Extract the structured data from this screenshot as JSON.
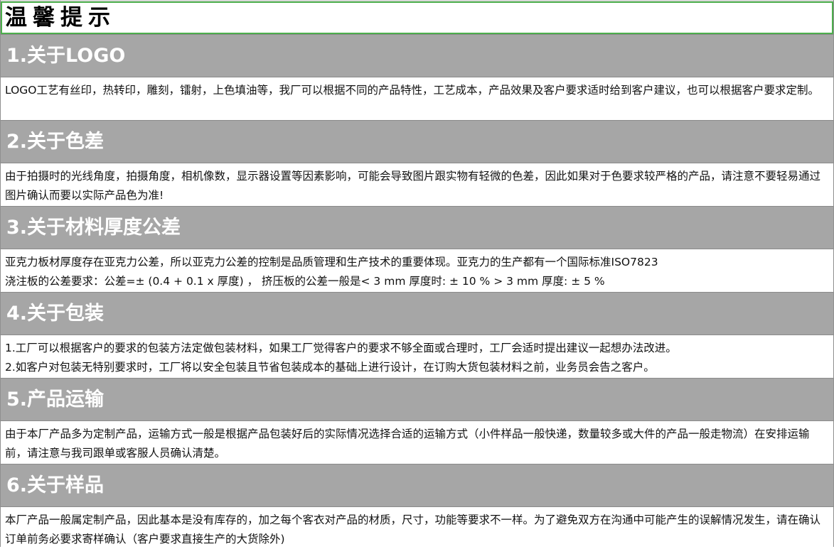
{
  "title": "温馨提示",
  "sections": [
    {
      "heading": "1.关于LOGO",
      "body": "LOGO工艺有丝印，热转印，雕刻，镭射，上色填油等，我厂可以根据不同的产品特性，工艺成本，产品效果及客户要求适时给到客户建议，也可以根据客户要求定制。"
    },
    {
      "heading": "2.关于色差",
      "body": "由于拍摄时的光线角度，拍摄角度，相机像数，显示器设置等因素影响，可能会导致图片跟实物有轻微的色差，因此如果对于色要求较严格的产品，请注意不要轻易通过图片确认而要以实际产品色为准!"
    },
    {
      "heading": "3.关于材料厚度公差",
      "line1": "亚克力板材厚度存在亚克力公差，所以亚克力公差的控制是品质管理和生产技术的重要体现。亚克力的生产都有一个国际标准ISO7823",
      "line2": "浇注板的公差要求：公差=± (0.4 + 0.1 x 厚度) ，   挤压板的公差一般是< 3 mm 厚度时: ± 10 % > 3 mm 厚度: ± 5 %"
    },
    {
      "heading": "4.关于包装",
      "line1": "1.工厂可以根据客户的要求的包装方法定做包装材料，如果工厂觉得客户的要求不够全面或合理时，工厂会适时提出建议一起想办法改进。",
      "line2": "2.如客户对包装无特别要求时，工厂将以安全包装且节省包装成本的基础上进行设计，在订购大货包装材料之前，业务员会告之客户。"
    },
    {
      "heading": "5.产品运输",
      "body": "由于本厂产品多为定制产品，运输方式一般是根据产品包装好后的实际情况选择合适的运输方式（小件样品一般快递，数量较多或大件的产品一般走物流）在安排运输前，请注意与我司跟单或客服人员确认清楚。"
    },
    {
      "heading": "6.关于样品",
      "body": "本厂产品一般属定制产品，因此基本是没有库存的，加之每个客衣对产品的材质，尺寸，功能等要求不一样。为了避免双方在沟通中可能产生的误解情况发生，请在确认订单前务必要求寄样确认（客户要求直接生产的大货除外)"
    }
  ]
}
